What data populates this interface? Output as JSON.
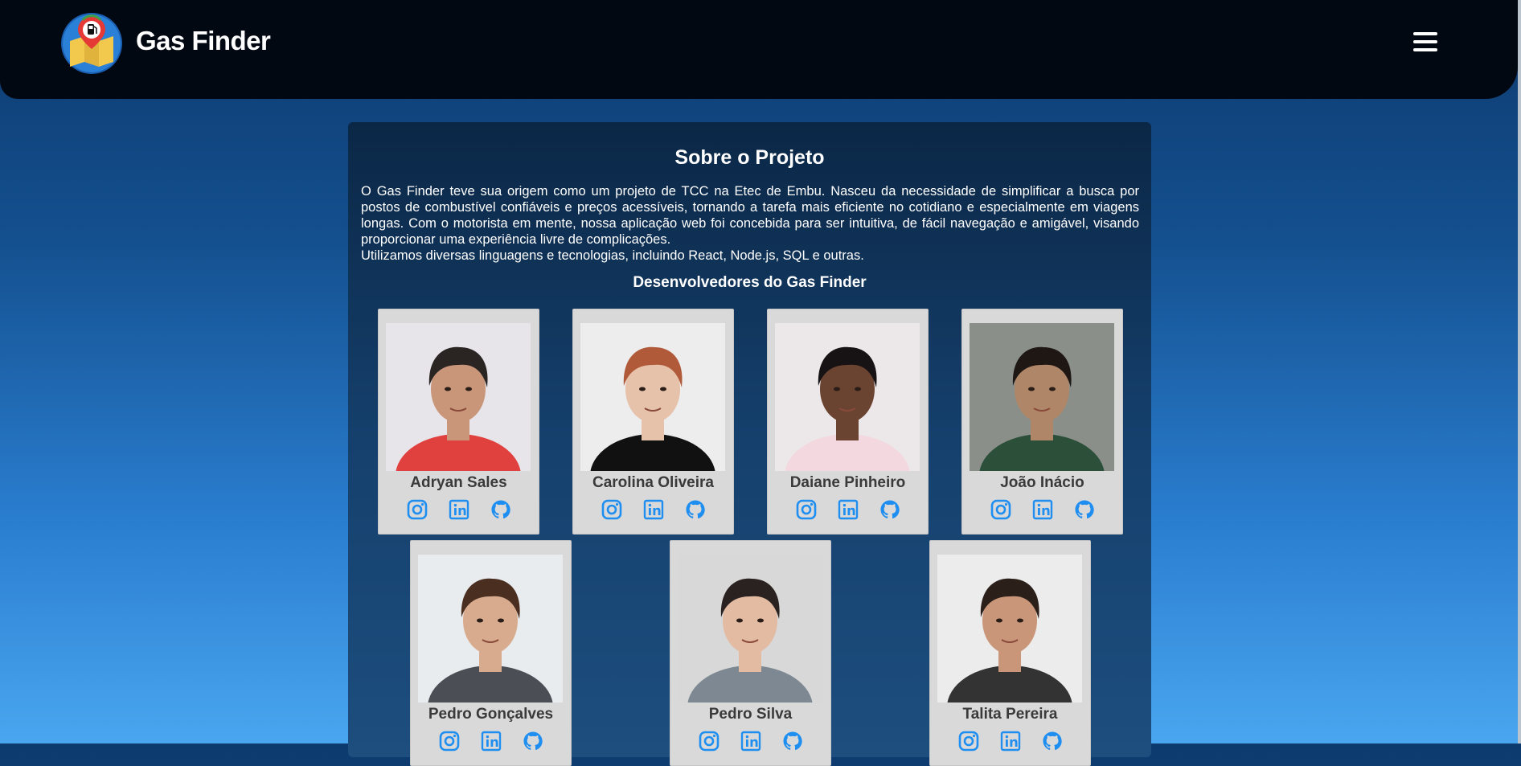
{
  "app": {
    "brand": "Gas Finder"
  },
  "colors": {
    "accent": "#1f8ef1",
    "navbar": "#020812",
    "card": "#d9d9d9"
  },
  "about": {
    "title": "Sobre o Projeto",
    "paragraph": "O Gas Finder teve sua origem como um projeto de TCC na Etec de Embu. Nasceu da necessidade de simplificar a busca por postos de combustível confiáveis e preços acessíveis, tornando a tarefa mais eficiente no cotidiano e especialmente em viagens longas. Com o motorista em mente, nossa aplicação web foi concebida para ser intuitiva, de fácil navegação e amigável, visando proporcionar uma experiência livre de complicações.",
    "tech": "Utilizamos diversas linguagens e tecnologias, incluindo React, Node.js, SQL e outras."
  },
  "developers": {
    "title": "Desenvolvedores do Gas Finder",
    "list": [
      {
        "name": "Adryan Sales"
      },
      {
        "name": "Carolina Oliveira"
      },
      {
        "name": "Daiane Pinheiro"
      },
      {
        "name": "João Inácio"
      },
      {
        "name": "Pedro Gonçalves"
      },
      {
        "name": "Pedro Silva"
      },
      {
        "name": "Talita Pereira"
      }
    ],
    "social_icons": [
      "instagram-icon",
      "linkedin-icon",
      "github-icon"
    ]
  }
}
